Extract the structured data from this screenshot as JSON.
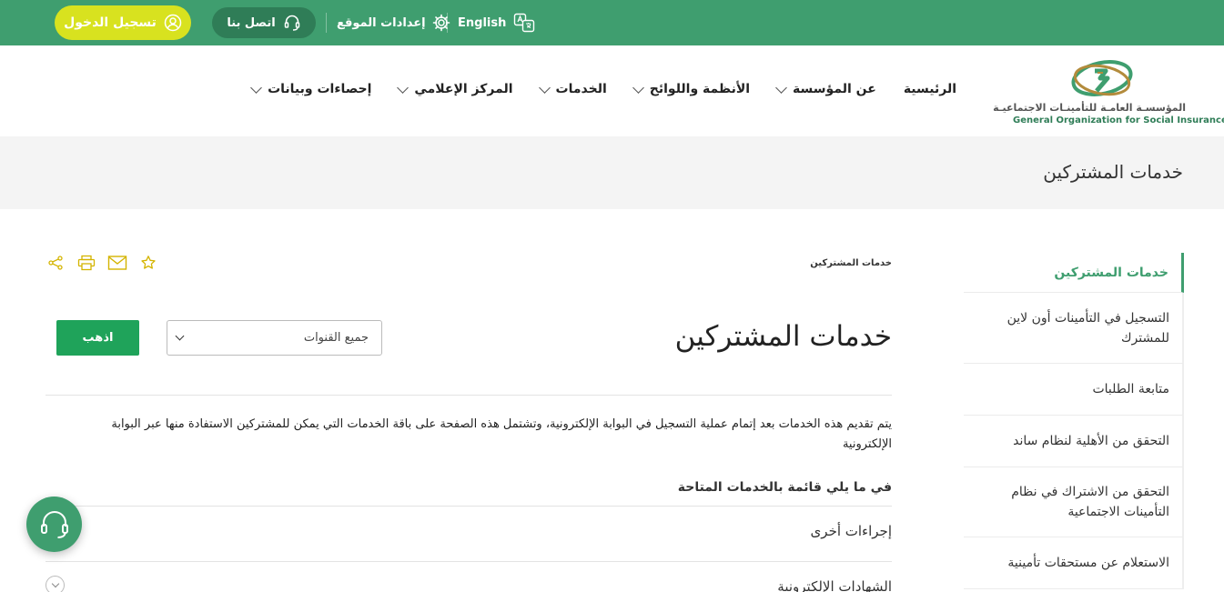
{
  "topbar": {
    "login_label": "تسجيل الدخول",
    "contact_label": "اتصل بنا",
    "settings_label": "إعدادات الموقع",
    "language_label": "English"
  },
  "header": {
    "logo_text_ar": "المؤسسـة العامـة للتأمينـات الاجتماعيـة",
    "logo_text_en": "General Organization for Social Insurance",
    "nav": [
      {
        "label": "الرئيسية"
      },
      {
        "label": "عن المؤسسة"
      },
      {
        "label": "الأنظمة واللوائح"
      },
      {
        "label": "الخدمات"
      },
      {
        "label": "المركز الإعلامي"
      },
      {
        "label": "إحصاءات وبيانات"
      }
    ]
  },
  "title_band": {
    "title": "خدمات المشتركين"
  },
  "sidebar": {
    "heading": "خدمات المشتركين",
    "items": [
      {
        "label": "التسجيل في التأمينات أون لاين للمشترك"
      },
      {
        "label": "متابعة الطلبات"
      },
      {
        "label": "التحقق من الأهلية لنظام ساند"
      },
      {
        "label": "التحقق من الاشتراك في نظام التأمينات الاجتماعية"
      },
      {
        "label": "الاستعلام عن مستحقات تأمينية"
      }
    ]
  },
  "main": {
    "breadcrumb": "خدمات المشتركين",
    "title": "خدمات المشتركين",
    "channel_select": {
      "selected": "جميع القنوات"
    },
    "go_label": "اذهب",
    "description": "يتم تقديم هذه الخدمات بعد إتمام عملية التسجيل في البوابة الإلكترونية، وتشتمل هذه الصفحة على باقة الخدمات التي يمكن للمشتركين الاستفادة منها عبر البوابة الإلكترونية",
    "services_heading": "في ما يلي قائمة بالخدمات المتاحة",
    "accordion": [
      {
        "label": "إجراءات أخرى"
      },
      {
        "label": "الشهادات الإلكترونية"
      }
    ]
  },
  "icons": {
    "login": "user-circle-icon",
    "contact": "headset-icon",
    "settings": "gear-icon",
    "language": "translate-icon",
    "tools": [
      "share-icon",
      "print-icon",
      "mail-icon",
      "star-icon"
    ],
    "fab": "headset-icon"
  },
  "colors": {
    "brand_green": "#3f9e6f",
    "dark_green": "#2f7d57",
    "login_yellow": "#d8e21f",
    "button_green": "#1fa35a",
    "tool_icon_yellow": "#d4b400"
  }
}
